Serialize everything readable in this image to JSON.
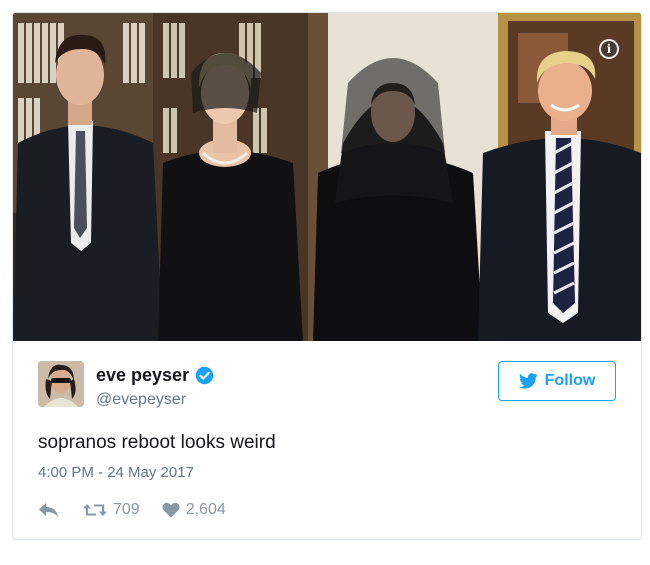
{
  "tweet": {
    "author": {
      "display_name": "eve peyser",
      "handle": "@evepeyser",
      "verified": true
    },
    "follow_label": "Follow",
    "text": "sopranos reboot looks weird",
    "timestamp": "4:00 PM - 24 May 2017",
    "retweet_count": "709",
    "like_count": "2,604",
    "photo_info_icon": "info-icon",
    "icons": {
      "reply": "reply-icon",
      "retweet": "retweet-icon",
      "like": "heart-icon",
      "verified": "verified-badge-icon",
      "follow": "twitter-bird-icon"
    }
  },
  "colors": {
    "accent": "#1da1f2",
    "text_primary": "#14171a",
    "text_secondary": "#657786",
    "action_gray": "#8899a6",
    "border": "#e1e8ed"
  }
}
